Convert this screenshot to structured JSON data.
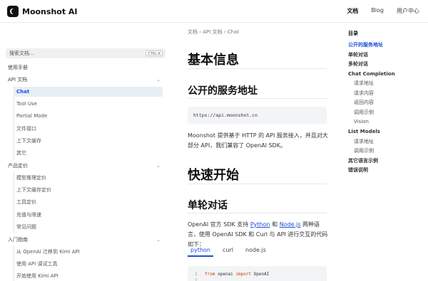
{
  "header": {
    "brand": "Moonshot AI",
    "nav": [
      "文档",
      "Blog",
      "用户中心"
    ]
  },
  "sidebar": {
    "search_placeholder": "搜索文档...",
    "search_kbd": "CTRL K",
    "items": [
      {
        "label": "使用手册",
        "level": 1,
        "expandable": false
      },
      {
        "label": "API 文档",
        "level": 1,
        "expandable": true
      },
      {
        "label": "Chat",
        "level": 2,
        "active": true
      },
      {
        "label": "Tool Use",
        "level": 2
      },
      {
        "label": "Partial Mode",
        "level": 2
      },
      {
        "label": "文件接口",
        "level": 2
      },
      {
        "label": "上下文缓存",
        "level": 2
      },
      {
        "label": "其它",
        "level": 2
      },
      {
        "label": "产品定价",
        "level": 1,
        "expandable": true
      },
      {
        "label": "模型推理定价",
        "level": 2
      },
      {
        "label": "上下文缓存定价",
        "level": 2
      },
      {
        "label": "工具定价",
        "level": 2
      },
      {
        "label": "充值与限速",
        "level": 2
      },
      {
        "label": "常见问题",
        "level": 2
      },
      {
        "label": "入门指南",
        "level": 1,
        "expandable": true
      },
      {
        "label": "从 OpenAI 迁移到 Kimi API",
        "level": 2
      },
      {
        "label": "使用 API 调试工具",
        "level": 2
      },
      {
        "label": "开始使用 Kimi API",
        "level": 2
      }
    ]
  },
  "main": {
    "breadcrumb": "文档 › API 文档 › Chat",
    "h1_basic": "基本信息",
    "h2_endpoint": "公开的服务地址",
    "endpoint_url": "https://api.moonshot.cn",
    "intro_para": "Moonshot 提供基于 HTTP 的 API 服务接入，并且对大部分 API，我们兼容了 OpenAI SDK。",
    "h1_quickstart": "快速开始",
    "h2_single": "单轮对话",
    "para2_prefix": "OpenAI 官方 SDK 支持 ",
    "para2_link1": "Python",
    "para2_mid": " 和 ",
    "para2_link2": "Node.js",
    "para2_suffix": " 两种语言，使用 OpenAI SDK 和 Curl 与 API 进行交互的代码如下：",
    "tabs": [
      "python",
      "curl",
      "node.js"
    ],
    "code": {
      "line1_no": "1",
      "line1_kw1": "from",
      "line1_mod": " openai ",
      "line1_kw2": "import",
      "line1_name": " OpenAI",
      "line2_no": "2"
    }
  },
  "toc": {
    "title": "目录",
    "items": [
      {
        "label": "公开的服务地址",
        "level": 1,
        "active": true
      },
      {
        "label": "单轮对话",
        "level": 1
      },
      {
        "label": "多轮对话",
        "level": 1
      },
      {
        "label": "Chat Completion",
        "level": 1
      },
      {
        "label": "请求地址",
        "level": 2
      },
      {
        "label": "请求内容",
        "level": 2
      },
      {
        "label": "返回内容",
        "level": 2
      },
      {
        "label": "调用示例",
        "level": 2
      },
      {
        "label": "Vision",
        "level": 2
      },
      {
        "label": "List Models",
        "level": 1
      },
      {
        "label": "请求地址",
        "level": 2
      },
      {
        "label": "调用示例",
        "level": 2
      },
      {
        "label": "其它语言示例",
        "level": 1
      },
      {
        "label": "错误说明",
        "level": 1
      }
    ]
  }
}
